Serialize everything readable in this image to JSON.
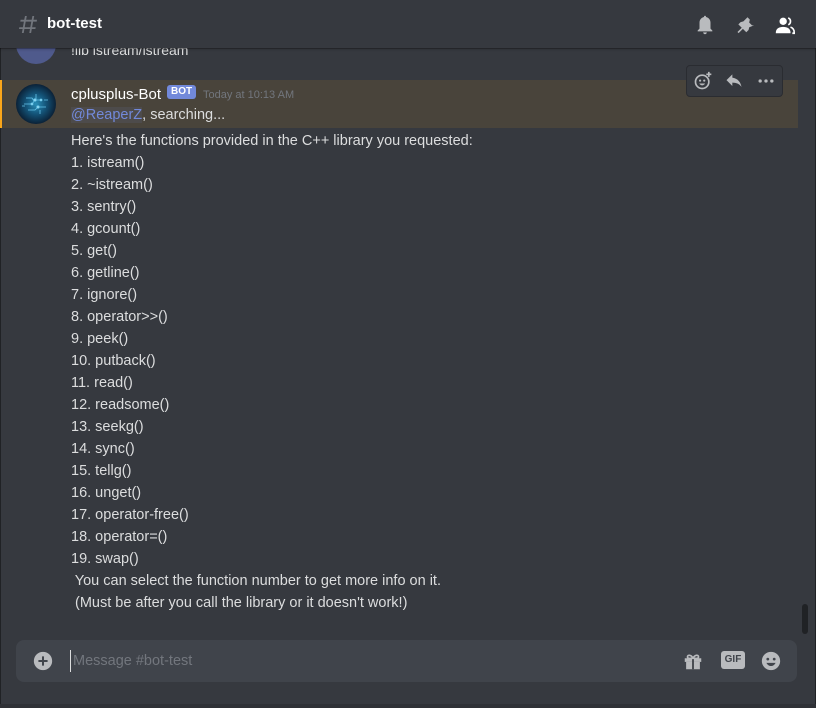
{
  "header": {
    "channel_name": "bot-test",
    "icons": [
      "hash-icon",
      "bell-icon",
      "pin-icon",
      "members-icon"
    ]
  },
  "previous_message": {
    "text": "!lib istream/istream"
  },
  "message": {
    "username": "cplusplus-Bot",
    "bot_tag": "BOT",
    "timestamp": "Today at 10:13 AM",
    "mention": "@ReaperZ",
    "first_line_rest": ", searching...",
    "intro": "Here's the functions provided in the C++ library you requested:",
    "functions": [
      "1. istream()",
      "2. ~istream()",
      "3. sentry()",
      "4. gcount()",
      "5. get()",
      "6. getline()",
      "7. ignore()",
      "8. operator>>()",
      "9. peek()",
      "10. putback()",
      "11. read()",
      "12. readsome()",
      "13. seekg()",
      "14. sync()",
      "15. tellg()",
      "16. unget()",
      "17. operator-free()",
      "18. operator=()",
      "19. swap()"
    ],
    "footer_lines": [
      " You can select the function number to get more info on it.",
      " (Must be after you call the library or it doesn't work!)"
    ]
  },
  "toolbar": {
    "icons": [
      "add-reaction-icon",
      "reply-icon",
      "more-icon"
    ]
  },
  "composer": {
    "placeholder": "Message #bot-test",
    "gif_label": "GIF",
    "icons": [
      "add-attachment-icon",
      "gift-icon",
      "gif-icon",
      "emoji-icon"
    ]
  },
  "colors": {
    "background": "#36393f",
    "accent": "#7289da",
    "highlight": "#faa61a",
    "composer": "#40444b"
  }
}
